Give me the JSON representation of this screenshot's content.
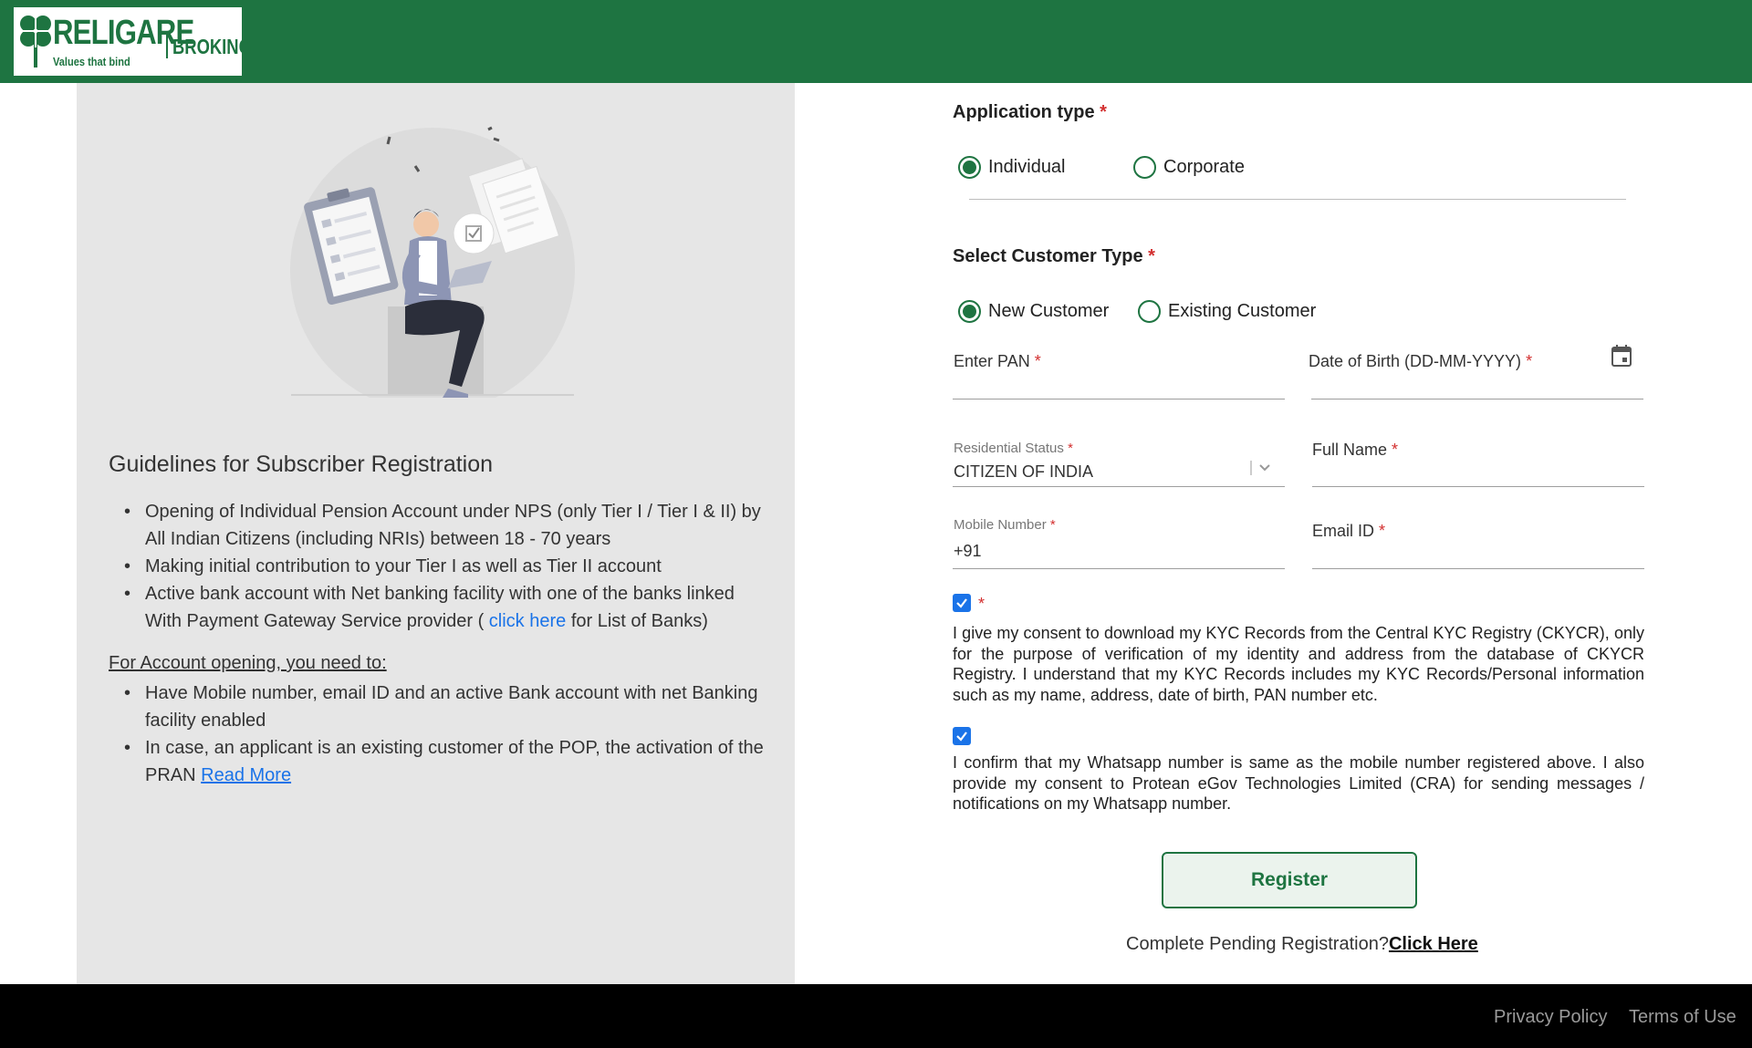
{
  "header": {
    "logo_brand": "RELIGARE",
    "logo_broking": "BROKING",
    "logo_tagline": "Values that bind"
  },
  "guidelines": {
    "title": "Guidelines for Subscriber Registration",
    "items": [
      "Opening of Individual Pension Account under NPS (only Tier I / Tier I & II) by All Indian Citizens (including NRIs) between 18 - 70 years",
      "Making initial contribution to your Tier I as well as Tier II account"
    ],
    "bank_item_prefix": "Active bank account with Net banking facility with one of the banks linked With Payment Gateway Service provider ( ",
    "bank_item_link": "click here",
    "bank_item_suffix": " for List of Banks)",
    "account_heading": "For Account opening, you need to:",
    "account_items": [
      "Have Mobile number, email ID and an active Bank account with net Banking facility enabled"
    ],
    "pop_item_text": "In case, an applicant is an existing customer of the POP, the activation of the PRAN ",
    "pop_item_link": "Read More"
  },
  "form": {
    "application_type": {
      "label": "Application type",
      "required_mark": "*",
      "options": [
        "Individual",
        "Corporate"
      ],
      "selected": "Individual"
    },
    "customer_type": {
      "label": "Select Customer Type",
      "required_mark": "*",
      "options": [
        "New Customer",
        "Existing Customer"
      ],
      "selected": "New Customer"
    },
    "pan": {
      "label": "Enter PAN",
      "required_mark": "*",
      "value": ""
    },
    "dob": {
      "label": "Date of Birth (DD-MM-YYYY)",
      "required_mark": "*",
      "icon": "calendar-icon"
    },
    "residential_status": {
      "label": "Residential Status",
      "required_mark": "*",
      "value": "CITIZEN OF INDIA"
    },
    "full_name": {
      "label": "Full Name",
      "required_mark": "*"
    },
    "mobile": {
      "label": "Mobile Number",
      "required_mark": "*",
      "prefix": "+91"
    },
    "email": {
      "label": "Email ID",
      "required_mark": "*"
    },
    "kyc_consent": {
      "checked": true,
      "required_mark": "*",
      "text": "I give my consent to download my KYC Records from the Central KYC Registry (CKYCR), only for the purpose of verification of my identity and address from the database of CKYCR Registry. I understand that my KYC Records includes my KYC Records/Personal information such as my name, address, date of birth, PAN number etc."
    },
    "whatsapp_consent": {
      "checked": true,
      "text": "I confirm that my Whatsapp number is same as the mobile number registered above. I also provide my consent to Protean eGov Technologies Limited (CRA) for sending messages / notifications on my Whatsapp number."
    },
    "register_label": "Register",
    "pending_text": "Complete Pending Registration?",
    "pending_link": "Click Here"
  },
  "footer": {
    "privacy": "Privacy Policy",
    "terms": "Terms of Use"
  },
  "colors": {
    "brand_green": "#1e7441",
    "link_blue": "#1a73e8",
    "required_red": "#d32f2f",
    "panel_grey": "#e6e6e6"
  }
}
